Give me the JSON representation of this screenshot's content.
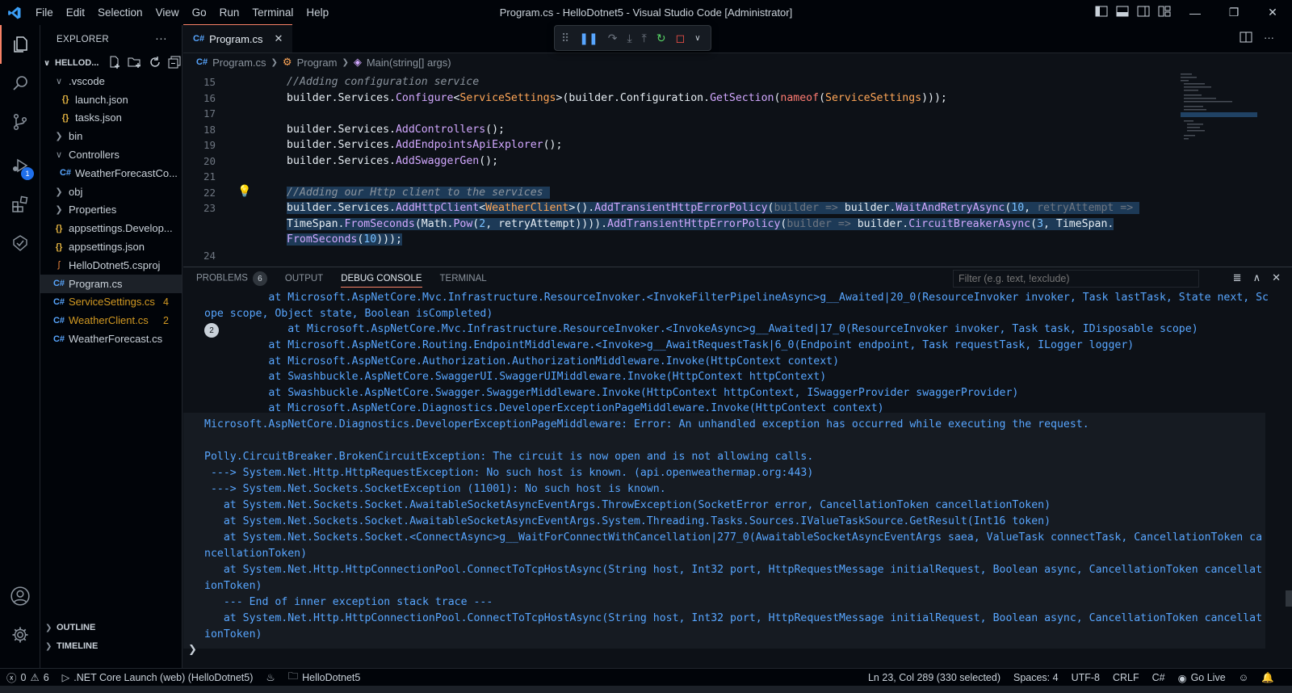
{
  "window": {
    "title": "Program.cs - HelloDotnet5 - Visual Studio Code [Administrator]",
    "menu": [
      "File",
      "Edit",
      "Selection",
      "View",
      "Go",
      "Run",
      "Terminal",
      "Help"
    ],
    "minimize": "—",
    "restore": "❐",
    "close": "✕"
  },
  "activity": {
    "debug_badge": "1"
  },
  "sidebar": {
    "header": "EXPLORER",
    "more": "···",
    "project": "HELLOD...",
    "items": [
      {
        "label": ".vscode",
        "icon": "chevron-down",
        "indent": 1
      },
      {
        "label": "launch.json",
        "icon": "json",
        "indent": 2
      },
      {
        "label": "tasks.json",
        "icon": "json",
        "indent": 2
      },
      {
        "label": "bin",
        "icon": "chevron-right",
        "indent": 1
      },
      {
        "label": "Controllers",
        "icon": "chevron-down",
        "indent": 1
      },
      {
        "label": "WeatherForecastCo...",
        "icon": "cs",
        "indent": 2
      },
      {
        "label": "obj",
        "icon": "chevron-right",
        "indent": 1
      },
      {
        "label": "Properties",
        "icon": "chevron-right",
        "indent": 1
      },
      {
        "label": "appsettings.Develop...",
        "icon": "json",
        "indent": 1
      },
      {
        "label": "appsettings.json",
        "icon": "json",
        "indent": 1
      },
      {
        "label": "HelloDotnet5.csproj",
        "icon": "rss",
        "indent": 1
      },
      {
        "label": "Program.cs",
        "icon": "cs",
        "indent": 1,
        "selected": true
      },
      {
        "label": "ServiceSettings.cs",
        "icon": "cs",
        "indent": 1,
        "count": "4",
        "warn": true
      },
      {
        "label": "WeatherClient.cs",
        "icon": "cs",
        "indent": 1,
        "count": "2",
        "warn": true
      },
      {
        "label": "WeatherForecast.cs",
        "icon": "cs",
        "indent": 1
      }
    ],
    "outline": "OUTLINE",
    "timeline": "TIMELINE"
  },
  "editor": {
    "tab": {
      "label": "Program.cs",
      "close": "✕"
    },
    "breadcrumb": [
      "Program.cs",
      "Program",
      "Main(string[] args)"
    ],
    "lines": [
      {
        "n": "15",
        "html": "<span class='c-cmt'>//Adding configuration service</span>"
      },
      {
        "n": "16",
        "html": "builder.Services.<span class='c-fn'>Configure</span>&lt;<span class='c-ty'>ServiceSettings</span>&gt;(builder.Configuration.<span class='c-fn'>GetSection</span>(<span class='c-kw'>nameof</span>(<span class='c-ty'>ServiceSettings</span>)));"
      },
      {
        "n": "17",
        "html": ""
      },
      {
        "n": "18",
        "html": "builder.Services.<span class='c-fn'>AddControllers</span>();"
      },
      {
        "n": "19",
        "html": "builder.Services.<span class='c-fn'>AddEndpointsApiExplorer</span>();"
      },
      {
        "n": "20",
        "html": "builder.Services.<span class='c-fn'>AddSwaggerGen</span>();"
      },
      {
        "n": "21",
        "html": ""
      },
      {
        "n": "22",
        "html": "<span class='sel c-cmt'>//Adding our Http client to the services </span>"
      },
      {
        "n": "23",
        "html": "<span class='sel'>builder.Services.<span class='c-fn'>AddHttpClient</span>&lt;<span class='c-ty'>WeatherClient</span>&gt;().<span class='c-fn'>AddTransientHttpErrorPolicy</span>(<span class='c-hint'>builder =&gt;</span> builder.<span class='c-fn'>WaitAndRetryAsync</span>(<span class='c-num'>10</span>, <span class='c-hint'>retryAttempt =&gt;</span> </span>"
      },
      {
        "n": "",
        "html": "<span class='sel'>TimeSpan.<span class='c-fn'>FromSeconds</span>(Math.<span class='c-fn'>Pow</span>(<span class='c-num'>2</span>, retryAttempt)))).<span class='c-fn'>AddTransientHttpErrorPolicy</span>(<span class='c-hint'>builder =&gt;</span> builder.<span class='c-fn'>CircuitBreakerAsync</span>(<span class='c-num'>3</span>, TimeSpan.</span>"
      },
      {
        "n": "",
        "html": "<span class='sel'><span class='c-fn'>FromSeconds</span>(<span class='c-num'>10</span>)));</span>"
      },
      {
        "n": "24",
        "html": ""
      }
    ]
  },
  "panel": {
    "tabs": [
      "PROBLEMS",
      "OUTPUT",
      "DEBUG CONSOLE",
      "TERMINAL"
    ],
    "problems_count": "6",
    "filter_placeholder": "Filter (e.g. text, !exclude)",
    "dup_badge": "2",
    "console": [
      "          at Microsoft.AspNetCore.Mvc.Infrastructure.ResourceInvoker.<InvokeFilterPipelineAsync>g__Awaited|20_0(ResourceInvoker invoker, Task lastTask, State next, Sc",
      "ope scope, Object state, Boolean isCompleted)",
      "             at Microsoft.AspNetCore.Mvc.Infrastructure.ResourceInvoker.<InvokeAsync>g__Awaited|17_0(ResourceInvoker invoker, Task task, IDisposable scope)",
      "          at Microsoft.AspNetCore.Routing.EndpointMiddleware.<Invoke>g__AwaitRequestTask|6_0(Endpoint endpoint, Task requestTask, ILogger logger)",
      "          at Microsoft.AspNetCore.Authorization.AuthorizationMiddleware.Invoke(HttpContext context)",
      "          at Swashbuckle.AspNetCore.SwaggerUI.SwaggerUIMiddleware.Invoke(HttpContext httpContext)",
      "          at Swashbuckle.AspNetCore.Swagger.SwaggerMiddleware.Invoke(HttpContext httpContext, ISwaggerProvider swaggerProvider)",
      "          at Microsoft.AspNetCore.Diagnostics.DeveloperExceptionPageMiddleware.Invoke(HttpContext context)",
      "Microsoft.AspNetCore.Diagnostics.DeveloperExceptionPageMiddleware: Error: An unhandled exception has occurred while executing the request.",
      "",
      "Polly.CircuitBreaker.BrokenCircuitException: The circuit is now open and is not allowing calls.",
      " ---> System.Net.Http.HttpRequestException: No such host is known. (api.openweathermap.org:443)",
      " ---> System.Net.Sockets.SocketException (11001): No such host is known.",
      "   at System.Net.Sockets.Socket.AwaitableSocketAsyncEventArgs.ThrowException(SocketError error, CancellationToken cancellationToken)",
      "   at System.Net.Sockets.Socket.AwaitableSocketAsyncEventArgs.System.Threading.Tasks.Sources.IValueTaskSource.GetResult(Int16 token)",
      "   at System.Net.Sockets.Socket.<ConnectAsync>g__WaitForConnectWithCancellation|277_0(AwaitableSocketAsyncEventArgs saea, ValueTask connectTask, CancellationToken ca",
      "ncellationToken)",
      "   at System.Net.Http.HttpConnectionPool.ConnectToTcpHostAsync(String host, Int32 port, HttpRequestMessage initialRequest, Boolean async, CancellationToken cancellat",
      "ionToken)",
      "   --- End of inner exception stack trace ---",
      "   at System.Net.Http.HttpConnectionPool.ConnectToTcpHostAsync(String host, Int32 port, HttpRequestMessage initialRequest, Boolean async, CancellationToken cancellat",
      "ionToken)"
    ],
    "prompt": "❯"
  },
  "status": {
    "errors": "0",
    "warnings": "6",
    "launch": ".NET Core Launch (web) (HelloDotnet5)",
    "folder": "HelloDotnet5",
    "position": "Ln 23, Col 289 (330 selected)",
    "spaces": "Spaces: 4",
    "encoding": "UTF-8",
    "eol": "CRLF",
    "lang": "C#",
    "golive": "Go Live"
  },
  "colors": {
    "accent": "#f78166",
    "link_blue": "#58a6ff",
    "warning": "#d29922",
    "badge_blue": "#1f6feb"
  }
}
